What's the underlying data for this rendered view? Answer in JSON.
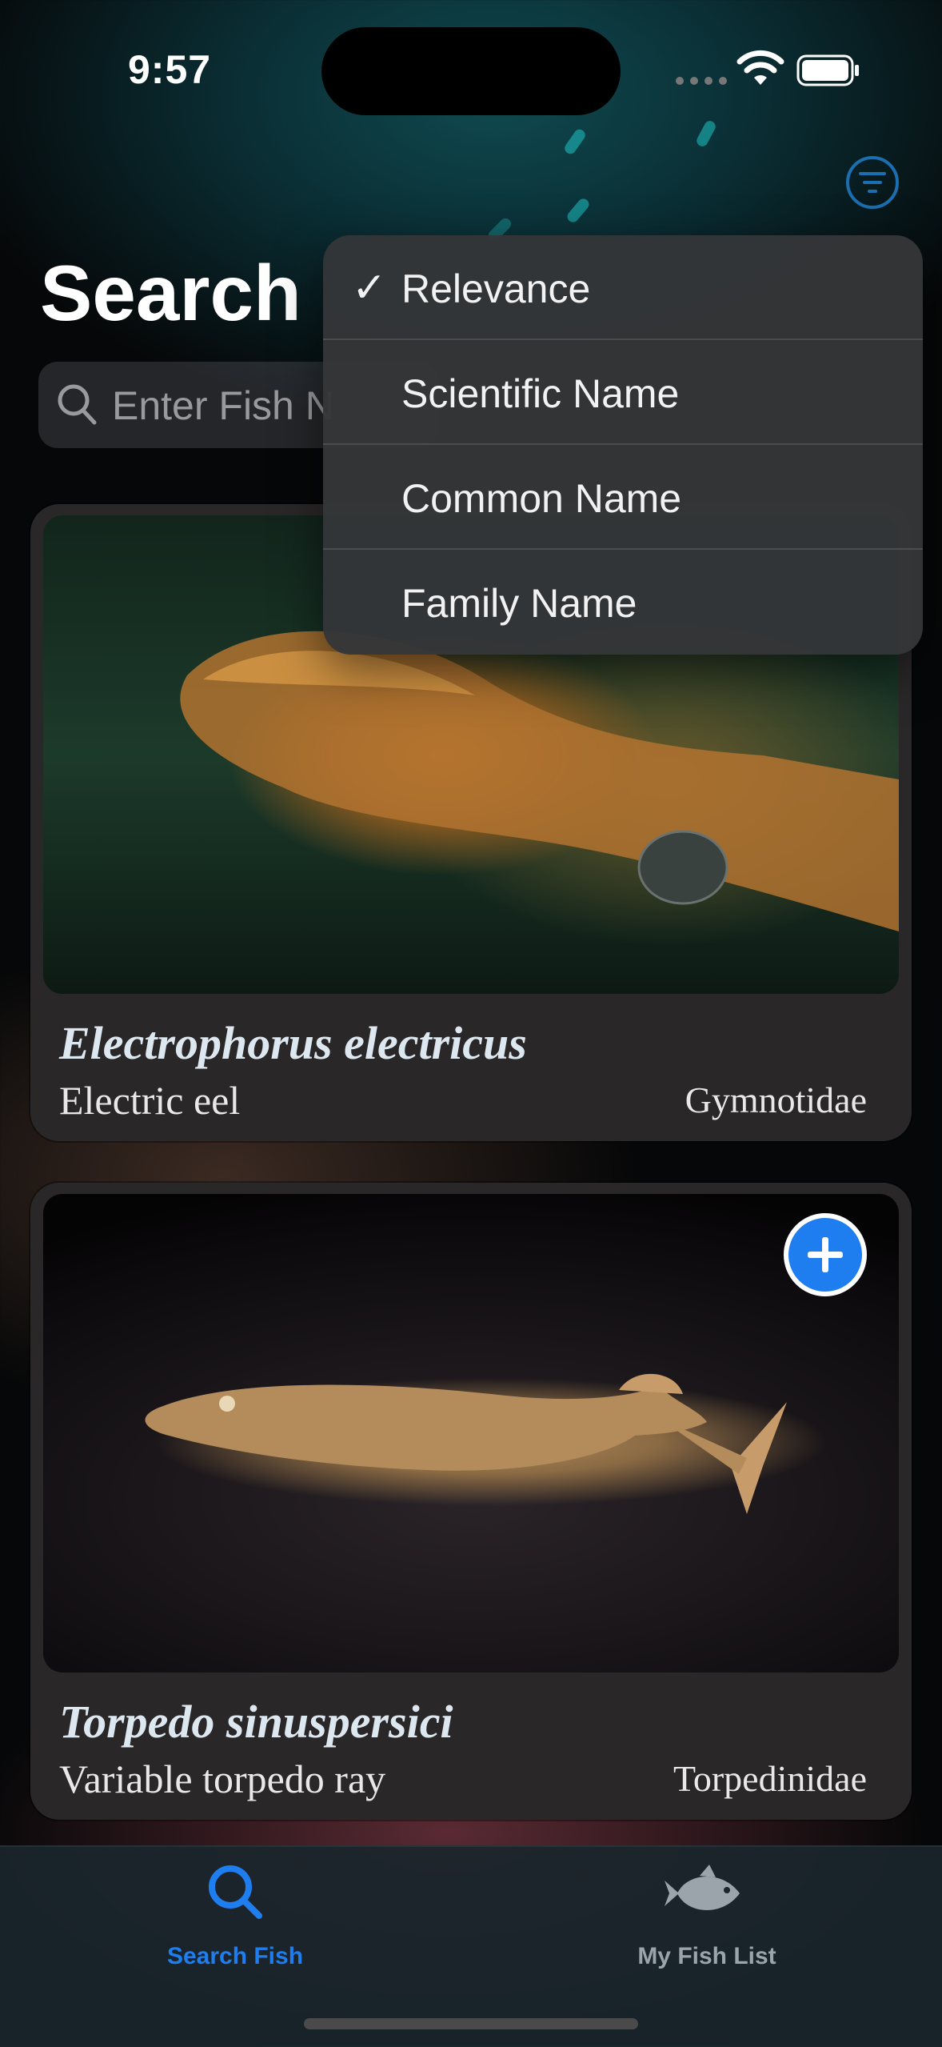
{
  "status_bar": {
    "time": "9:57"
  },
  "header": {
    "title": "Search",
    "filter_icon": "line-3-horizontal-decrease-circle-icon"
  },
  "search": {
    "placeholder": "Enter Fish N"
  },
  "sort_menu": {
    "items": [
      {
        "label": "Relevance",
        "checked": true
      },
      {
        "label": "Scientific Name",
        "checked": false
      },
      {
        "label": "Common Name",
        "checked": false
      },
      {
        "label": "Family Name",
        "checked": false
      }
    ],
    "check_mark": "✓"
  },
  "results": [
    {
      "scientific_name": "Electrophorus electricus",
      "common_name": "Electric eel",
      "family": "Gymnotidae"
    },
    {
      "scientific_name": "Torpedo sinuspersici",
      "common_name": "Variable torpedo ray",
      "family": "Torpedinidae"
    }
  ],
  "tab_bar": {
    "tabs": [
      {
        "label": "Search Fish",
        "icon": "magnifyingglass-icon",
        "active": true,
        "color": "#1e7ef0"
      },
      {
        "label": "My Fish List",
        "icon": "fish-icon",
        "active": false,
        "color": "#9aa4aa"
      }
    ]
  }
}
